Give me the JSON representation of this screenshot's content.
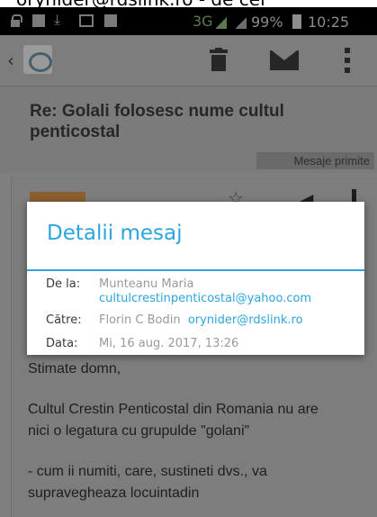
{
  "top_caption": "orynider@rdslink.ro - de cel",
  "status_bar": {
    "network": "3G",
    "battery": "99%",
    "time": "10:25"
  },
  "icons": {
    "back": "chevron-left-icon",
    "app": "email-app-icon",
    "delete": "trash-icon",
    "mark_unread": "envelope-icon",
    "more": "overflow-menu-icon",
    "star": "star-icon",
    "reply": "reply-icon"
  },
  "message": {
    "subject": "Re: Golali folosesc nume cultul penticostal",
    "folder": "Mesaje primite"
  },
  "dialog": {
    "title": "Detalii mesaj",
    "from_label": "De la:",
    "from_name": "Munteanu Maria",
    "from_email": "cultulcrestinpenticostal@yahoo.com",
    "to_label": "Către:",
    "to_name": "Florin C Bodin",
    "to_email": "orynider@rdslink.ro",
    "date_label": "Data:",
    "date_value": "Mi, 16 aug. 2017, 13:26"
  },
  "body": {
    "greeting": "Stimate domn,",
    "para1_line1": "Cultul Crestin Penticostal din Romania nu are",
    "para1_line2": "nici o legatura cu grupulde \"golani\"",
    "para2_line1": " - cum ii numiti, care, sustineti dvs., va",
    "para2_line2": "supravegheaza locuintadin"
  },
  "colors": {
    "accent": "#2ba5de",
    "dim_overlay": "#7d7d7d"
  }
}
